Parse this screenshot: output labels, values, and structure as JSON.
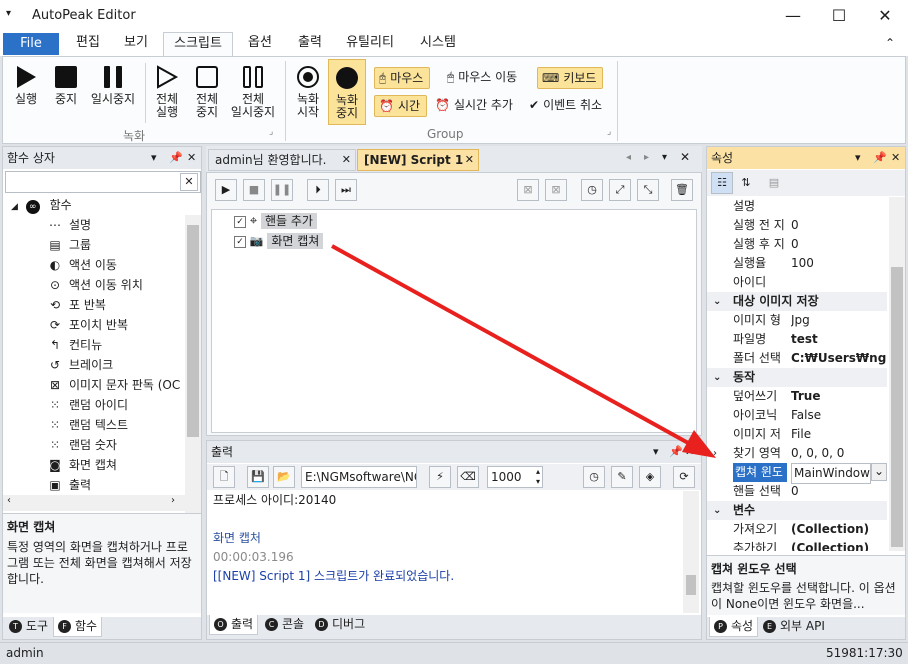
{
  "window": {
    "title": "AutoPeak Editor",
    "sysmenu": "▾",
    "min": "—",
    "max": "☐",
    "close": "✕"
  },
  "menu": {
    "tabs": [
      "File",
      "편집",
      "보기",
      "스크립트",
      "옵션",
      "출력",
      "유틸리티",
      "시스템"
    ],
    "active": "스크립트",
    "collapse": "⌃"
  },
  "ribbon": {
    "run": "실행",
    "stop": "중지",
    "pause": "일시중지",
    "run_all_1": "전체",
    "run_all_2": "실행",
    "stop_all_1": "전체",
    "stop_all_2": "중지",
    "pause_all_1": "전체",
    "pause_all_2": "일시중지",
    "rec_start_1": "녹화",
    "rec_start_2": "시작",
    "rec_stop_1": "녹화",
    "rec_stop_2": "중지",
    "mouse": "마우스",
    "mouse_move": "마우스 이동",
    "keyboard": "키보드",
    "time": "시간",
    "realtime_add": "실시간 추가",
    "event_cancel": "이벤트 취소",
    "group_record": "녹화",
    "group_group": "Group"
  },
  "left_panel": {
    "title": "함수 상자",
    "root": "함수",
    "items": [
      "설명",
      "그룹",
      "액션 이동",
      "액션 이동 위치",
      "포 반복",
      "포이치 반복",
      "컨티뉴",
      "브레이크",
      "이미지 문자 판독 (OC",
      "랜덤 아이디",
      "랜덤 텍스트",
      "랜덤 숫자",
      "화면 캡쳐",
      "출력"
    ],
    "item_icons": [
      "⋯",
      "▤",
      "◐",
      "⊙",
      "⟲",
      "⟳",
      "↰",
      "↺",
      "⊠",
      "⁙",
      "⁙",
      "⁙",
      "◙",
      "▣"
    ],
    "desc_title": "화면 캡쳐",
    "desc_text": "특정 영역의 화면을 캡쳐하거나 프로그램 또는 전체 화면을 캡쳐해서 저장합니다.",
    "tabs": [
      "도구",
      "함수"
    ],
    "tab_letters": [
      "T",
      "F"
    ]
  },
  "editor": {
    "tabs": [
      "admin님 환영합니다.",
      "[NEW] Script 1"
    ],
    "script_items": [
      "핸들 추가",
      "화면 캡쳐"
    ]
  },
  "output": {
    "title": "출력",
    "path": "E:\\NGMsoftware\\NG",
    "interval": "1000",
    "lines": [
      {
        "text": "프로세스 아이디:20140",
        "color": "#1e1e1e"
      },
      {
        "text": "",
        "color": "#1e1e1e"
      },
      {
        "text": "화면 캡처",
        "color": "#2b4fa0"
      },
      {
        "text": "00:00:03.196",
        "color": "#8a8a8a"
      },
      {
        "text": "[[NEW] Script 1] 스크립트가 완료되었습니다.",
        "color": "#1a3fa8"
      }
    ],
    "tabs": [
      "출력",
      "콘솔",
      "디버그"
    ],
    "tab_letters": [
      "O",
      "C",
      "D"
    ]
  },
  "properties": {
    "title": "속성",
    "rows": [
      {
        "type": "prop",
        "name": "설명",
        "value": ""
      },
      {
        "type": "prop",
        "name": "실행 전 지",
        "value": "0"
      },
      {
        "type": "prop",
        "name": "실행 후 지",
        "value": "0"
      },
      {
        "type": "prop",
        "name": "실행율",
        "value": "100"
      },
      {
        "type": "prop",
        "name": "아이디",
        "value": ""
      },
      {
        "type": "cat",
        "name": "대상 이미지 저장",
        "value": ""
      },
      {
        "type": "prop",
        "name": "이미지 형",
        "value": "Jpg"
      },
      {
        "type": "prop",
        "name": "파일명",
        "value": "test",
        "bold": true
      },
      {
        "type": "prop",
        "name": "폴더 선택",
        "value": "C:₩Users₩ngma",
        "bold": true
      },
      {
        "type": "cat",
        "name": "동작",
        "value": ""
      },
      {
        "type": "prop",
        "name": "덮어쓰기",
        "value": "True",
        "bold": true
      },
      {
        "type": "prop",
        "name": "아이코닉",
        "value": "False"
      },
      {
        "type": "prop",
        "name": "이미지 저",
        "value": "File"
      },
      {
        "type": "prop",
        "name": "찾기 영역",
        "value": "0, 0, 0, 0",
        "expand": "›"
      },
      {
        "type": "prop",
        "name": "캡쳐 윈도",
        "value": "MainWindow",
        "selected": true
      },
      {
        "type": "prop",
        "name": "핸들 선택",
        "value": "0"
      },
      {
        "type": "cat",
        "name": "변수",
        "value": ""
      },
      {
        "type": "prop",
        "name": "가져오기",
        "value": "(Collection)",
        "bold": true
      },
      {
        "type": "prop",
        "name": "추가하기",
        "value": "(Collection)",
        "bold": true
      }
    ],
    "desc_title": "캡쳐 윈도우 선택",
    "desc_text": "캡쳐할 윈도우를 선택합니다. 이 옵션이 None이면 윈도우 화면을...",
    "tabs": [
      "속성",
      "외부 API"
    ],
    "tab_letters": [
      "P",
      "E"
    ]
  },
  "status": {
    "user": "admin",
    "time": "51981:17:30"
  },
  "colors": {
    "accent": "#2b71c8",
    "active_header": "#fbe2a4",
    "arrow": "#e8201e",
    "record_on": "#fce39a"
  }
}
